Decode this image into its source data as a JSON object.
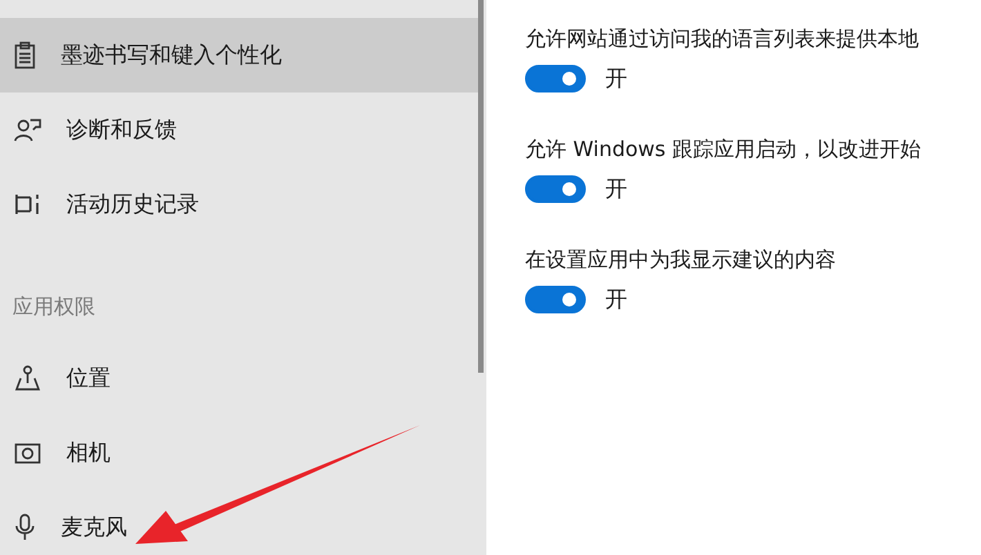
{
  "sidebar": {
    "items": [
      {
        "label": "墨迹书写和键入个性化",
        "selected": true
      },
      {
        "label": "诊断和反馈",
        "selected": false
      },
      {
        "label": "活动历史记录",
        "selected": false
      }
    ],
    "section_header": "应用权限",
    "permission_items": [
      {
        "label": "位置",
        "selected": false
      },
      {
        "label": "相机",
        "selected": false
      },
      {
        "label": "麦克风",
        "selected": false
      }
    ]
  },
  "settings": [
    {
      "label": "允许网站通过访问我的语言列表来提供本地",
      "on": true,
      "state_label": "开"
    },
    {
      "label": "允许 Windows 跟踪应用启动，以改进开始",
      "on": true,
      "state_label": "开"
    },
    {
      "label": "在设置应用中为我显示建议的内容",
      "on": true,
      "state_label": "开"
    }
  ]
}
